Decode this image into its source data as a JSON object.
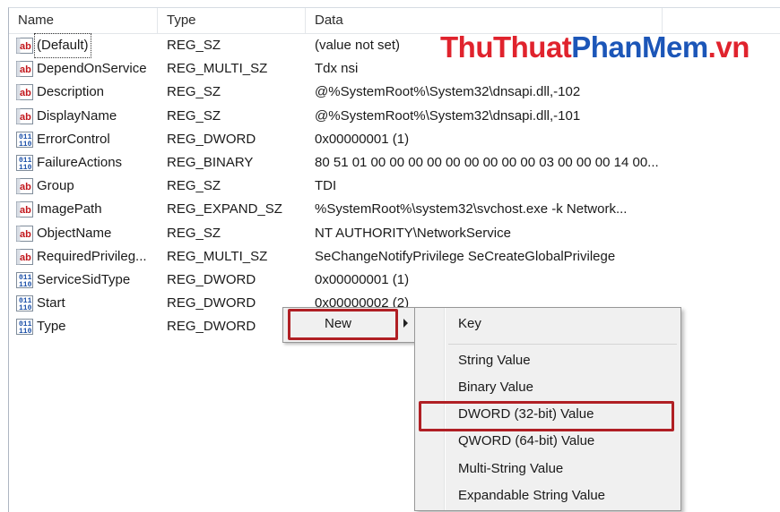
{
  "columns": {
    "name": "Name",
    "type": "Type",
    "data": "Data"
  },
  "rows": [
    {
      "icon": "string-value-icon",
      "name": "(Default)",
      "type": "REG_SZ",
      "data": "(value not set)"
    },
    {
      "icon": "string-value-icon",
      "name": "DependOnService",
      "type": "REG_MULTI_SZ",
      "data": "Tdx nsi"
    },
    {
      "icon": "string-value-icon",
      "name": "Description",
      "type": "REG_SZ",
      "data": "@%SystemRoot%\\System32\\dnsapi.dll,-102"
    },
    {
      "icon": "string-value-icon",
      "name": "DisplayName",
      "type": "REG_SZ",
      "data": "@%SystemRoot%\\System32\\dnsapi.dll,-101"
    },
    {
      "icon": "binary-value-icon",
      "name": "ErrorControl",
      "type": "REG_DWORD",
      "data": "0x00000001 (1)"
    },
    {
      "icon": "binary-value-icon",
      "name": "FailureActions",
      "type": "REG_BINARY",
      "data": "80 51 01 00 00 00 00 00 00 00 00 00 03 00 00 00 14 00..."
    },
    {
      "icon": "string-value-icon",
      "name": "Group",
      "type": "REG_SZ",
      "data": "TDI"
    },
    {
      "icon": "string-value-icon",
      "name": "ImagePath",
      "type": "REG_EXPAND_SZ",
      "data": "%SystemRoot%\\system32\\svchost.exe -k Network..."
    },
    {
      "icon": "string-value-icon",
      "name": "ObjectName",
      "type": "REG_SZ",
      "data": "NT AUTHORITY\\NetworkService"
    },
    {
      "icon": "string-value-icon",
      "name": "RequiredPrivileg...",
      "type": "REG_MULTI_SZ",
      "data": "SeChangeNotifyPrivilege SeCreateGlobalPrivilege"
    },
    {
      "icon": "binary-value-icon",
      "name": "ServiceSidType",
      "type": "REG_DWORD",
      "data": "0x00000001 (1)"
    },
    {
      "icon": "binary-value-icon",
      "name": "Start",
      "type": "REG_DWORD",
      "data": "0x00000002 (2)"
    },
    {
      "icon": "binary-value-icon",
      "name": "Type",
      "type": "REG_DWORD",
      "data": ""
    }
  ],
  "watermark": {
    "part1": "ThuThuat",
    "part2": "PhanMem",
    "part3": ".vn"
  },
  "context_menu": {
    "new_label": "New"
  },
  "submenu": {
    "items": [
      {
        "label": "Key"
      },
      {
        "label": "String Value"
      },
      {
        "label": "Binary Value"
      },
      {
        "label": "DWORD (32-bit) Value"
      },
      {
        "label": "QWORD (64-bit) Value"
      },
      {
        "label": "Multi-String Value"
      },
      {
        "label": "Expandable String Value"
      }
    ]
  },
  "colors": {
    "highlight_border": "#b01f24",
    "watermark_red": "#e0232d",
    "watermark_blue": "#1c56b8"
  }
}
